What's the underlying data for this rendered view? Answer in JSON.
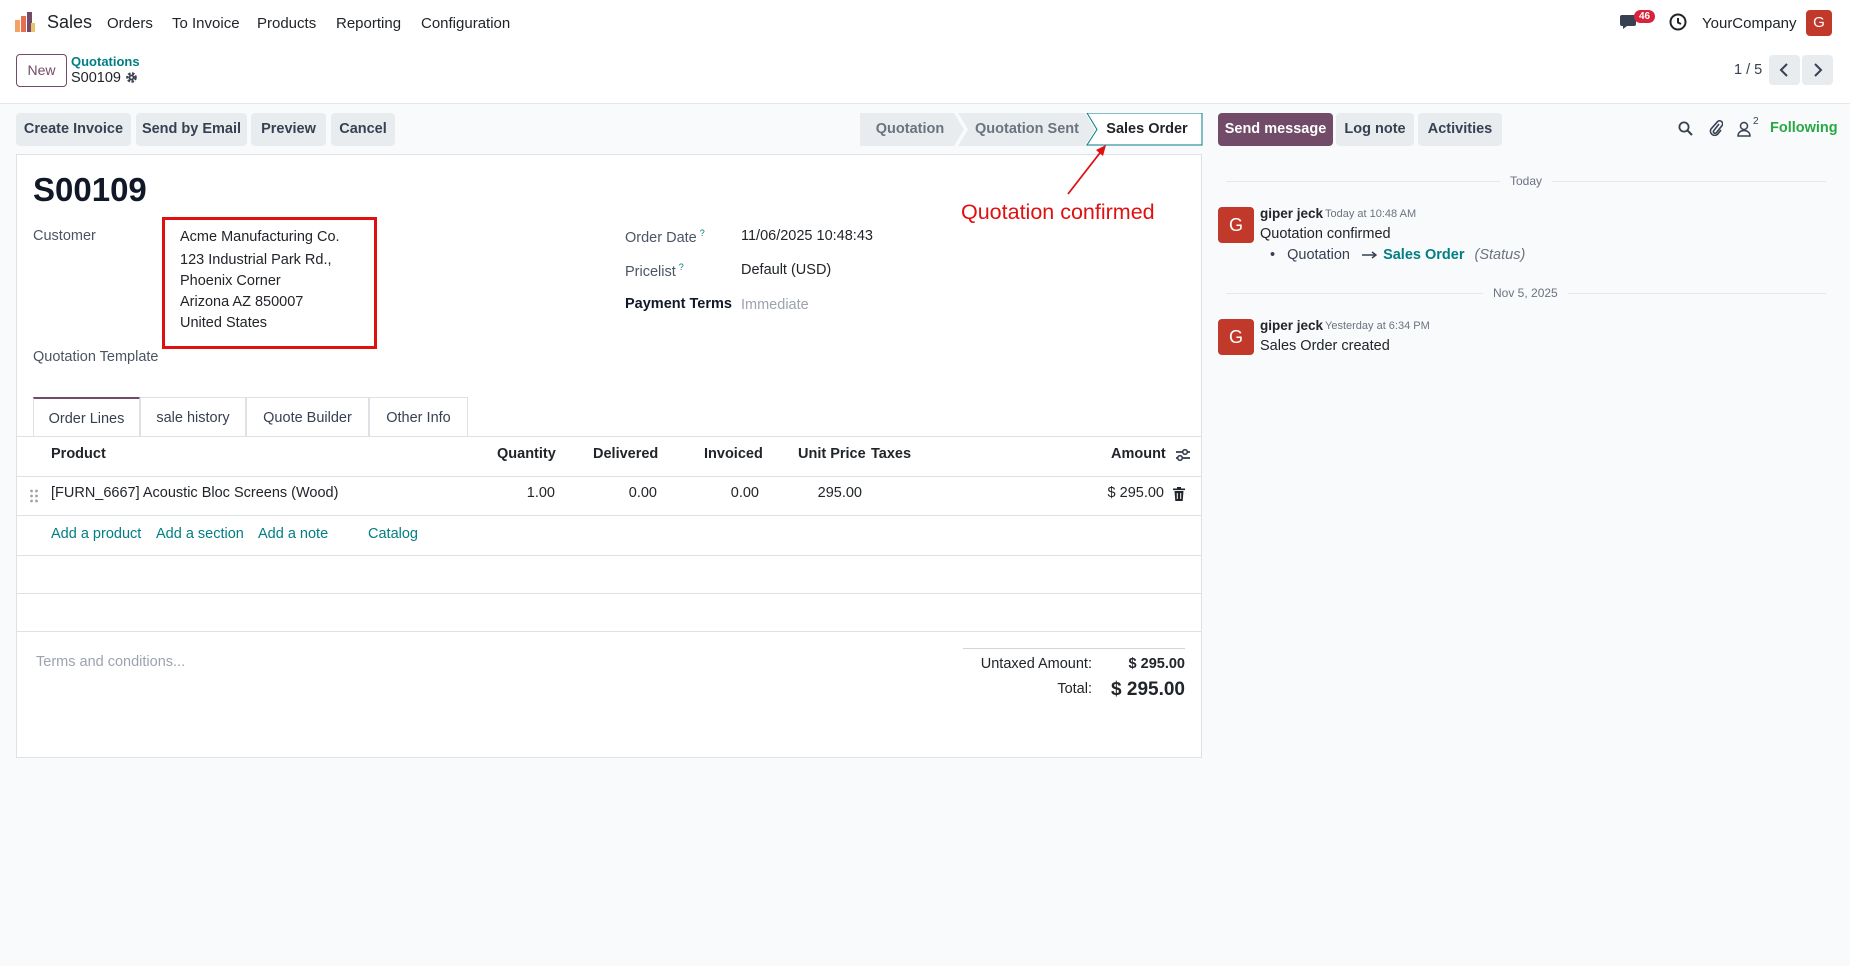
{
  "topnav": {
    "app_name": "Sales",
    "menu": [
      "Orders",
      "To Invoice",
      "Products",
      "Reporting",
      "Configuration"
    ],
    "notification_count": "46",
    "company": "YourCompany",
    "user_initial": "G"
  },
  "control": {
    "new_label": "New",
    "breadcrumb_parent": "Quotations",
    "breadcrumb_current": "S00109",
    "pager": "1 / 5"
  },
  "actions": {
    "create_invoice": "Create Invoice",
    "send_by_email": "Send by Email",
    "preview": "Preview",
    "cancel": "Cancel"
  },
  "statusbar": {
    "stages": [
      "Quotation",
      "Quotation Sent",
      "Sales Order"
    ],
    "current": "Sales Order"
  },
  "form": {
    "name": "S00109",
    "customer_label": "Customer",
    "customer_name": "Acme Manufacturing Co.",
    "address": [
      "123 Industrial Park Rd.,",
      "Phoenix Corner",
      "Arizona AZ 850007",
      "United States"
    ],
    "template_label": "Quotation Template",
    "order_date_label": "Order Date",
    "order_date": "11/06/2025 10:48:43",
    "pricelist_label": "Pricelist",
    "pricelist": "Default (USD)",
    "payment_terms_label": "Payment Terms",
    "payment_terms_placeholder": "Immediate",
    "help_mark": "?"
  },
  "annotation": "Quotation confirmed",
  "tabs": [
    "Order Lines",
    "sale history",
    "Quote Builder",
    "Other Info"
  ],
  "order_lines": {
    "columns": {
      "product": "Product",
      "quantity": "Quantity",
      "delivered": "Delivered",
      "invoiced": "Invoiced",
      "unit_price": "Unit Price",
      "taxes": "Taxes",
      "amount": "Amount"
    },
    "rows": [
      {
        "product": "[FURN_6667] Acoustic Bloc Screens (Wood)",
        "quantity": "1.00",
        "delivered": "0.00",
        "invoiced": "0.00",
        "unit_price": "295.00",
        "taxes": "",
        "amount": "$ 295.00"
      }
    ],
    "add_links": [
      "Add a product",
      "Add a section",
      "Add a note",
      "Catalog"
    ]
  },
  "footer": {
    "terms_placeholder": "Terms and conditions...",
    "untaxed_label": "Untaxed Amount:",
    "untaxed_value": "$ 295.00",
    "total_label": "Total:",
    "total_value": "$ 295.00"
  },
  "chatter": {
    "send_message": "Send message",
    "log_note": "Log note",
    "activities": "Activities",
    "follower_count": "2",
    "following": "Following",
    "groups": [
      {
        "date": "Today",
        "author": "giper jeck",
        "time": "Today at 10:48 AM",
        "body": "Quotation confirmed",
        "change_old": "Quotation",
        "change_new": "Sales Order",
        "change_field": "(Status)"
      },
      {
        "date": "Nov 5, 2025",
        "author": "giper jeck",
        "time": "Yesterday at 6:34 PM",
        "body": "Sales Order created"
      }
    ],
    "author_initial": "G"
  },
  "colors": {
    "brand": "#714b67",
    "link": "#017e84",
    "annotation": "#e01010",
    "following": "#28a745"
  }
}
